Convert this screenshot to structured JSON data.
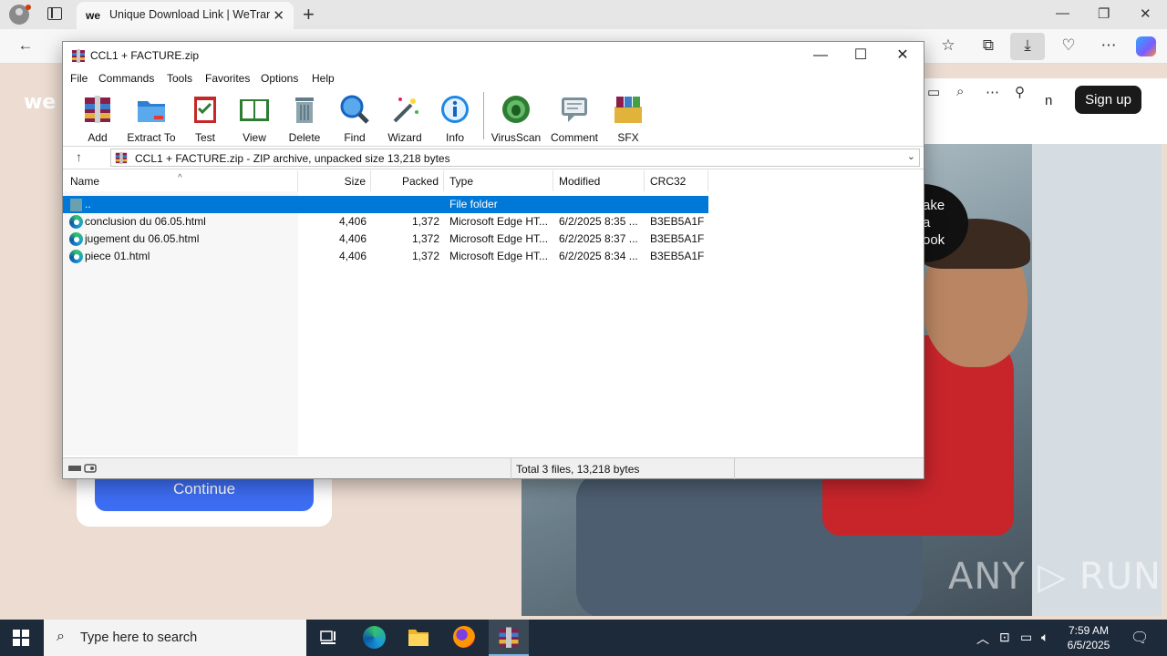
{
  "browser": {
    "tab_title": "Unique Download Link | WeTransfer",
    "tab_favicon": "we",
    "new_tab_symbol": "+",
    "close_symbol": "✕"
  },
  "webpage": {
    "logo": "we",
    "signup_label": "Sign up",
    "partial_text_n": "n",
    "photo_badge_text": "ake\na\nook",
    "continue_label": "Continue",
    "watermark": "ANY ▷ RUN"
  },
  "winrar": {
    "title": "CCL1 + FACTURE.zip",
    "menu": [
      "File",
      "Commands",
      "Tools",
      "Favorites",
      "Options",
      "Help"
    ],
    "toolbar": [
      {
        "label": "Add",
        "icon": "add-archive-icon"
      },
      {
        "label": "Extract To",
        "icon": "extract-folder-icon"
      },
      {
        "label": "Test",
        "icon": "test-clipboard-icon"
      },
      {
        "label": "View",
        "icon": "view-book-icon"
      },
      {
        "label": "Delete",
        "icon": "delete-bin-icon"
      },
      {
        "label": "Find",
        "icon": "find-magnifier-icon"
      },
      {
        "label": "Wizard",
        "icon": "wizard-wand-icon"
      },
      {
        "label": "Info",
        "icon": "info-icon"
      },
      {
        "label": "VirusScan",
        "icon": "virusscan-icon"
      },
      {
        "label": "Comment",
        "icon": "comment-icon"
      },
      {
        "label": "SFX",
        "icon": "sfx-icon"
      }
    ],
    "address": "CCL1 + FACTURE.zip - ZIP archive, unpacked size 13,218 bytes",
    "columns": [
      "Name",
      "Size",
      "Packed",
      "Type",
      "Modified",
      "CRC32"
    ],
    "rows": [
      {
        "name": "..",
        "size": "",
        "packed": "",
        "type": "File folder",
        "modified": "",
        "crc": "",
        "kind": "folder"
      },
      {
        "name": "conclusion du 06.05.html",
        "size": "4,406",
        "packed": "1,372",
        "type": "Microsoft Edge HT...",
        "modified": "6/2/2025 8:35 ...",
        "crc": "B3EB5A1F",
        "kind": "edge"
      },
      {
        "name": "jugement du 06.05.html",
        "size": "4,406",
        "packed": "1,372",
        "type": "Microsoft Edge HT...",
        "modified": "6/2/2025 8:37 ...",
        "crc": "B3EB5A1F",
        "kind": "edge"
      },
      {
        "name": "piece 01.html",
        "size": "4,406",
        "packed": "1,372",
        "type": "Microsoft Edge HT...",
        "modified": "6/2/2025 8:34 ...",
        "crc": "B3EB5A1F",
        "kind": "edge"
      }
    ],
    "status": "Total 3 files, 13,218 bytes"
  },
  "taskbar": {
    "search_placeholder": "Type here to search",
    "time": "7:59 AM",
    "date": "6/5/2025"
  },
  "colors": {
    "selection": "#0078d7",
    "taskbar": "#1c2a3a",
    "continue_button": "#3d6df2",
    "page_bg": "#ecdcd1"
  }
}
